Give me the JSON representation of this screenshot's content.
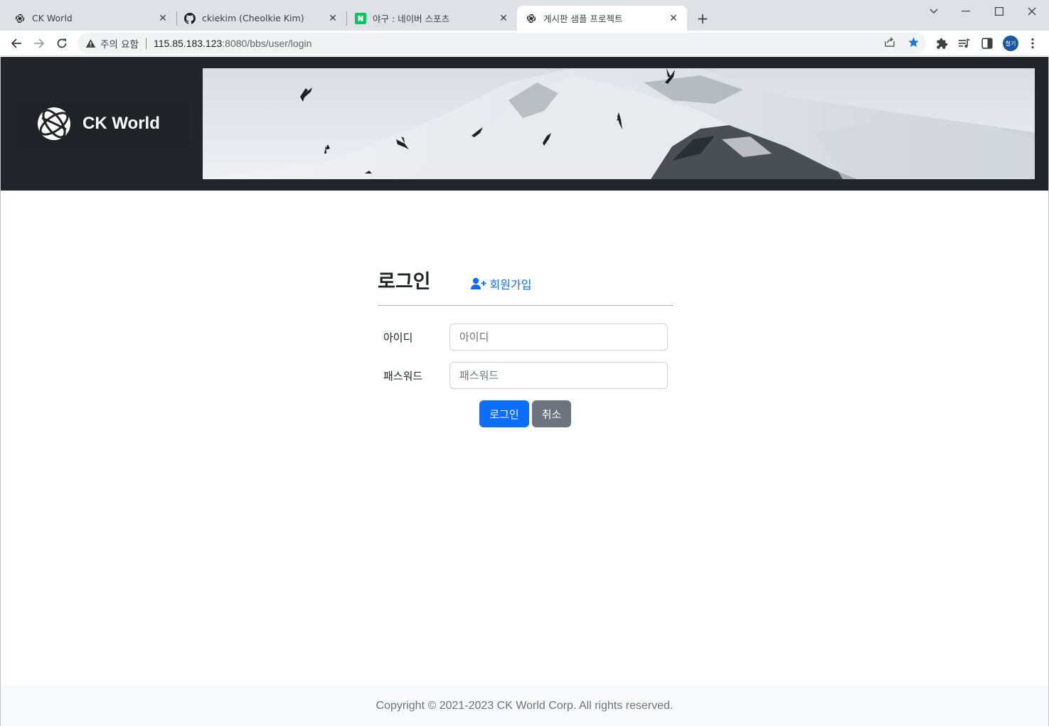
{
  "browser": {
    "tabs": [
      {
        "title": "CK World",
        "icon": "globe-icon"
      },
      {
        "title": "ckiekim (Cheolkie Kim)",
        "icon": "github-icon"
      },
      {
        "title": "야구 : 네이버 스포츠",
        "icon": "naver-icon"
      },
      {
        "title": "게시판 샘플 프로젝트",
        "icon": "globe-icon"
      }
    ],
    "active_tab": 3,
    "security_label": "주의 요함",
    "url_host": "115.85.183.123",
    "url_path": ":8080/bbs/user/login",
    "profile_initials": "철기",
    "colors": {
      "tabstrip": "#dee1e6",
      "star": "#1a73e8",
      "profile": "#1a57a3"
    }
  },
  "site": {
    "brand_name": "CK World",
    "colors": {
      "header_bg": "#212529",
      "primary": "#0d6efd",
      "secondary": "#6c757d"
    }
  },
  "login": {
    "title": "로그인",
    "signup_link": "회원가입",
    "id_label": "아이디",
    "id_placeholder": "아이디",
    "id_value": "",
    "password_label": "패스워드",
    "password_placeholder": "패스워드",
    "password_value": "",
    "submit_label": "로그인",
    "cancel_label": "취소"
  },
  "footer": {
    "copyright": "Copyright © 2021-2023 CK World Corp. All rights reserved."
  }
}
